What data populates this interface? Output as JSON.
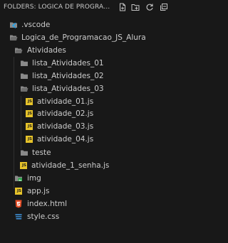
{
  "header": {
    "title": "FOLDERS: LOGICA DE PROGRAMACAO_JS_ALURA",
    "actions": [
      {
        "icon": "new-file-icon"
      },
      {
        "icon": "new-folder-icon"
      },
      {
        "icon": "refresh-icon"
      },
      {
        "icon": "collapse-all-icon"
      }
    ]
  },
  "tree": {
    "vscode": {
      "label": ".vscode",
      "icon": "vscode-folder-icon"
    },
    "root": {
      "label": "Logica_de_Programacao_JS_Alura",
      "icon": "folder-open-icon"
    },
    "atividades": {
      "label": "Atividades",
      "icon": "folder-open-icon"
    },
    "lista01": {
      "label": "lista_Atividades_01",
      "icon": "folder-icon"
    },
    "lista02": {
      "label": "lista_Atividades_02",
      "icon": "folder-icon"
    },
    "lista03": {
      "label": "lista_Atividades_03",
      "icon": "folder-open-icon"
    },
    "ativ01": {
      "label": "atividade_01.js",
      "icon": "js-file-icon"
    },
    "ativ02": {
      "label": "atividade_02.js",
      "icon": "js-file-icon"
    },
    "ativ03": {
      "label": "atividade_03.js",
      "icon": "js-file-icon"
    },
    "ativ04": {
      "label": "atividade_04.js",
      "icon": "js-file-icon"
    },
    "teste": {
      "label": "teste",
      "icon": "folder-icon"
    },
    "senha": {
      "label": "atividade_1_senha.js",
      "icon": "js-file-icon"
    },
    "img": {
      "label": "img",
      "icon": "image-folder-icon"
    },
    "appjs": {
      "label": "app.js",
      "icon": "js-file-icon"
    },
    "index": {
      "label": "index.html",
      "icon": "html-file-icon"
    },
    "style": {
      "label": "style.css",
      "icon": "css-file-icon"
    }
  },
  "colors": {
    "background": "#181818",
    "text": "#cccccc",
    "folder": "#8a8a8a",
    "js": "#e6c32a",
    "html": "#e44d26",
    "css": "#3d8fd6",
    "vscode": "#22a0e8",
    "img": "#2aa84a"
  }
}
